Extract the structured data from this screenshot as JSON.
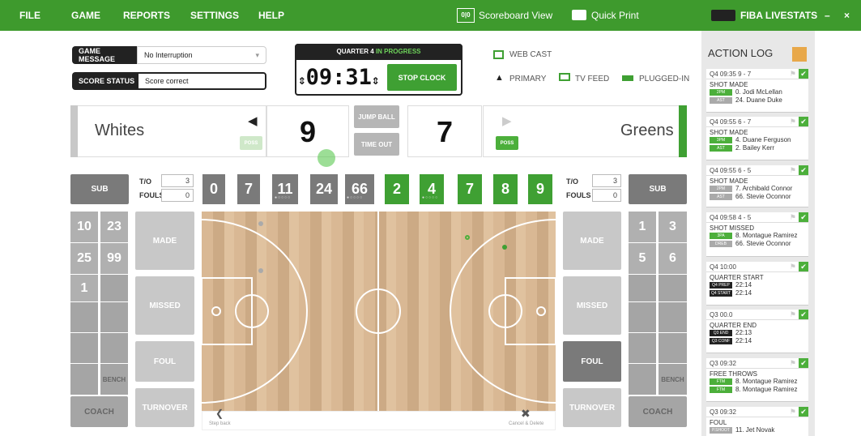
{
  "menu": {
    "file": "FILE",
    "game": "GAME",
    "reports": "REPORTS",
    "settings": "SETTINGS",
    "help": "HELP"
  },
  "toolbar": {
    "scoreboard": "Scoreboard View",
    "print": "Quick Print",
    "brand": "FIBA LIVESTATS",
    "minimize": "–",
    "close": "×"
  },
  "game_message": {
    "label": "GAME MESSAGE",
    "value": "No Interruption"
  },
  "score_status": {
    "label": "SCORE STATUS",
    "value": "Score correct"
  },
  "quarter": {
    "prefix": "QUARTER 4",
    "status": "IN PROGRESS",
    "clock": "09:31",
    "stop": "STOP CLOCK"
  },
  "feeds": {
    "webcast": "WEB CAST",
    "primary": "PRIMARY",
    "tvfeed": "TV FEED",
    "plugged": "PLUGGED-IN"
  },
  "home": {
    "name": "Whites",
    "score": "9",
    "poss": "POSS",
    "to_label": "T/O",
    "to": "3",
    "fouls_label": "FOULS",
    "fouls": "0",
    "sub": "SUB",
    "players": [
      "0",
      "7",
      "11",
      "24",
      "66"
    ],
    "bench": [
      "10",
      "23",
      "25",
      "99",
      "1"
    ],
    "bench_label": "BENCH",
    "coach": "COACH",
    "made": "MADE",
    "missed": "MISSED",
    "foul": "FOUL",
    "turnover": "TURNOVER"
  },
  "away": {
    "name": "Greens",
    "score": "7",
    "poss": "POSS",
    "to_label": "T/O",
    "to": "3",
    "fouls_label": "FOULS",
    "fouls": "0",
    "sub": "SUB",
    "players": [
      "2",
      "4",
      "7",
      "8",
      "9"
    ],
    "bench": [
      "1",
      "3",
      "5",
      "6"
    ],
    "bench_label": "BENCH",
    "coach": "COACH",
    "made": "MADE",
    "missed": "MISSED",
    "foul": "FOUL",
    "turnover": "TURNOVER"
  },
  "center": {
    "jump_ball": "JUMP BALL",
    "time_out": "TIME OUT"
  },
  "court": {
    "step_back": "Step back",
    "cancel": "Cancel & Delete"
  },
  "log": {
    "title": "ACTION LOG",
    "entries": [
      {
        "hdr": "Q4  09:35   9 - 7",
        "event": "SHOT MADE",
        "lines": [
          {
            "tag": "2PM",
            "tc": "tg",
            "text": "0. Jodi McLellan"
          },
          {
            "tag": "AST",
            "tc": "tgr",
            "text": "24. Duane Duke"
          }
        ]
      },
      {
        "hdr": "Q4  09:55   6 - 7",
        "event": "SHOT MADE",
        "lines": [
          {
            "tag": "3PM",
            "tc": "tg",
            "text": "4. Duane Ferguson"
          },
          {
            "tag": "AST",
            "tc": "tg",
            "text": "2. Bailey Kerr"
          }
        ]
      },
      {
        "hdr": "Q4  09:55   6 - 5",
        "event": "SHOT MADE",
        "lines": [
          {
            "tag": "2PM",
            "tc": "tgr",
            "text": "7. Archibald Connor"
          },
          {
            "tag": "AST",
            "tc": "tgr",
            "text": "66. Stevie Oconnor"
          }
        ]
      },
      {
        "hdr": "Q4  09:58   4 - 5",
        "event": "SHOT MISSED",
        "lines": [
          {
            "tag": "3PA",
            "tc": "tg",
            "text": "8. Montague Ramirez"
          },
          {
            "tag": "DREB",
            "tc": "tgr",
            "text": "66. Stevie Oconnor"
          }
        ]
      },
      {
        "hdr": "Q4  10:00",
        "event": "QUARTER START",
        "lines": [
          {
            "tag": "Q4 PREP",
            "tc": "tb",
            "text": "22:14"
          },
          {
            "tag": "Q4 START",
            "tc": "tb",
            "text": "22:14"
          }
        ]
      },
      {
        "hdr": "Q3  00.0",
        "event": "QUARTER END",
        "lines": [
          {
            "tag": "Q3 END",
            "tc": "tb",
            "text": "22:13"
          },
          {
            "tag": "Q3 CONF",
            "tc": "tb",
            "text": "22:14"
          }
        ]
      },
      {
        "hdr": "Q3  09:32",
        "event": "FREE THROWS",
        "lines": [
          {
            "tag": "FTM",
            "tc": "tg",
            "text": "8. Montague Ramirez"
          },
          {
            "tag": "FTM",
            "tc": "tg",
            "text": "8. Montague Ramirez"
          }
        ]
      },
      {
        "hdr": "Q3  09:32",
        "event": "FOUL",
        "lines": [
          {
            "tag": "P.SHOOT",
            "tc": "tgr",
            "text": "11. Jet Novak"
          }
        ]
      }
    ]
  }
}
